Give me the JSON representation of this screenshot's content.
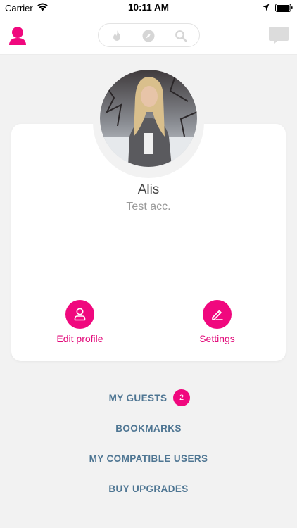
{
  "status_bar": {
    "carrier": "Carrier",
    "time": "10:11 AM"
  },
  "nav": {
    "left_icon": "profile-icon",
    "center_icons": [
      "fire-icon",
      "compass-icon",
      "search-icon"
    ],
    "right_icon": "chat-icon"
  },
  "profile": {
    "name": "Alis",
    "status": "Test acc.",
    "actions": [
      {
        "label": "Edit profile",
        "icon": "user-icon"
      },
      {
        "label": "Settings",
        "icon": "pencil-icon"
      }
    ]
  },
  "links": {
    "my_guests": "MY GUESTS",
    "my_guests_badge": "2",
    "bookmarks": "BOOKMARKS",
    "compatible_users": "MY COMPATIBLE USERS",
    "buy_upgrades": "BUY UPGRADES"
  },
  "colors": {
    "accent": "#f0087e",
    "link": "#4f7693",
    "background": "#f2f2f2"
  }
}
